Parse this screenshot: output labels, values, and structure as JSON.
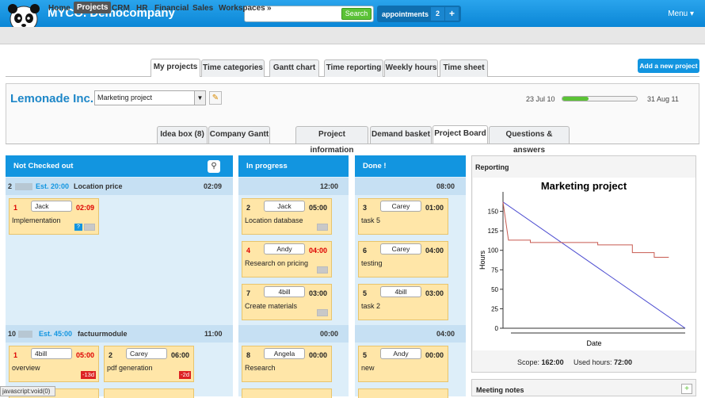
{
  "app": {
    "name": "MYCO. Democompany",
    "search_label": "Search",
    "appointments_label": "appointments",
    "appointments_count": "2",
    "plus": "+",
    "menu_label": "Menu ▾"
  },
  "nav": {
    "items": [
      "Home",
      "Projects",
      "CRM",
      "HR",
      "Financial",
      "Sales",
      "Workspaces",
      "»"
    ]
  },
  "tabs": [
    "My projects",
    "Time categories",
    "Gantt chart",
    "Time reporting",
    "Weekly hours",
    "Time sheet"
  ],
  "add_project_label": "Add a new project",
  "project": {
    "company": "Lemonade Inc.",
    "selected": "Marketing project",
    "start_date": "23 Jul 10",
    "end_date": "31 Aug 11",
    "progress": 0.35
  },
  "subtabs": [
    "Idea box (8)",
    "Company Gantt",
    "Project information",
    "Demand basket",
    "Project Board",
    "Questions & answers"
  ],
  "board": {
    "columns": [
      "Not Checked out",
      "In progress",
      "Done !"
    ],
    "groups": [
      {
        "num": "2",
        "est": "Est. 20:00",
        "name": "Location price",
        "time": "02:09",
        "ip_time": "12:00",
        "done_time": "08:00"
      },
      {
        "num": "10",
        "est": "Est. 45:00",
        "name": "factuurmodule",
        "time": "11:00",
        "ip_time": "00:00",
        "done_time": "04:00"
      }
    ],
    "cards": [
      {
        "num": "1",
        "who": "Jack",
        "hrs": "02:09",
        "title": "Implementation",
        "q": "?"
      },
      {
        "num": "2",
        "who": "Jack",
        "hrs": "05:00",
        "title": "Location database"
      },
      {
        "num": "4",
        "who": "Andy",
        "hrs": "04:00",
        "title": "Research on pricing"
      },
      {
        "num": "7",
        "who": "4bill",
        "hrs": "03:00",
        "title": "Create materials"
      },
      {
        "num": "3",
        "who": "Carey",
        "hrs": "01:00",
        "title": "task 5"
      },
      {
        "num": "6",
        "who": "Carey",
        "hrs": "04:00",
        "title": "testing"
      },
      {
        "num": "5",
        "who": "4bill",
        "hrs": "03:00",
        "title": "task 2"
      },
      {
        "num": "1",
        "who": "4bill",
        "hrs": "05:00",
        "title": "overview",
        "late": "-13d"
      },
      {
        "num": "2",
        "who": "Carey",
        "hrs": "06:00",
        "title": "pdf generation",
        "late": "-2d"
      },
      {
        "num": "8",
        "who": "Angela",
        "hrs": "00:00",
        "title": "Research"
      },
      {
        "num": "5",
        "who": "Andy",
        "hrs": "00:00",
        "title": "new"
      }
    ]
  },
  "reporting": {
    "title": "Reporting",
    "scope_label": "Scope:",
    "scope": "162:00",
    "used_label": "Used hours:",
    "used": "72:00",
    "meeting_notes": "Meeting notes",
    "plus": "+"
  },
  "chart_data": {
    "type": "line",
    "title": "Marketing project",
    "xlabel": "Date",
    "ylabel": "Hours",
    "ylim": [
      0,
      175
    ],
    "yticks": [
      0,
      25,
      50,
      75,
      100,
      125,
      150
    ],
    "series": [
      {
        "color": "#4a4ad0",
        "values": [
          [
            0,
            162
          ],
          [
            100,
            0
          ]
        ]
      },
      {
        "color": "#c85a50",
        "values": [
          [
            0,
            162
          ],
          [
            3,
            113
          ],
          [
            15,
            113
          ],
          [
            15,
            110
          ],
          [
            52,
            110
          ],
          [
            52,
            107
          ],
          [
            71,
            107
          ],
          [
            71,
            97
          ],
          [
            83,
            97
          ],
          [
            83,
            91
          ],
          [
            91,
            91
          ]
        ]
      }
    ]
  },
  "status": "javascript:void(0)",
  "colors": {
    "accent": "#1295e0",
    "brand_green": "#5bc236",
    "card": "#ffe6a8"
  }
}
